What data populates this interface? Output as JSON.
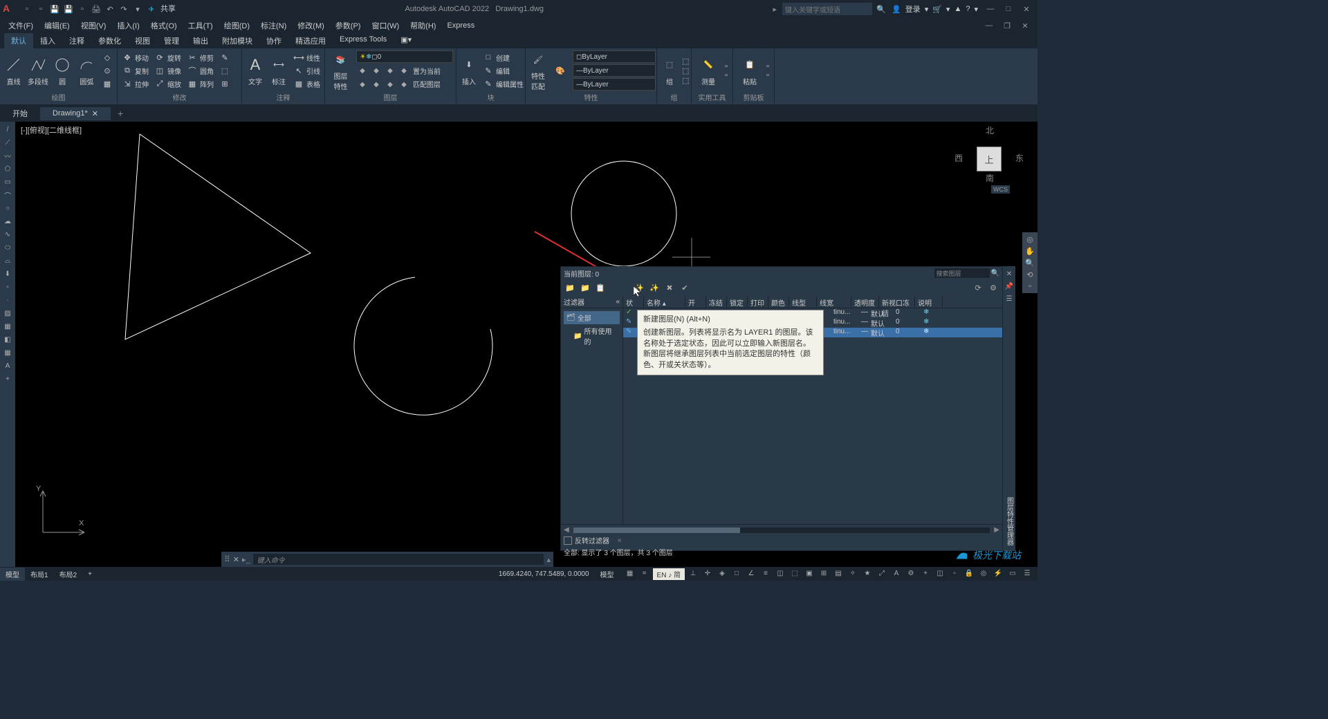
{
  "title": {
    "app": "Autodesk AutoCAD 2022",
    "file": "Drawing1.dwg"
  },
  "qat_share": "共享",
  "search_placeholder": "键入关键字或短语",
  "login_label": "登录",
  "menu": {
    "file": "文件(F)",
    "edit": "编辑(E)",
    "view": "视图(V)",
    "insert": "插入(I)",
    "format": "格式(O)",
    "tools": "工具(T)",
    "draw": "绘图(D)",
    "dimension": "标注(N)",
    "modify": "修改(M)",
    "param": "参数(P)",
    "window": "窗口(W)",
    "help": "帮助(H)",
    "express": "Express"
  },
  "ribbon_tabs": {
    "default": "默认",
    "insert": "插入",
    "annotate": "注释",
    "param": "参数化",
    "view": "视图",
    "manage": "管理",
    "output": "输出",
    "addons": "附加模块",
    "collab": "协作",
    "featured": "精选应用",
    "express": "Express Tools"
  },
  "ribbon": {
    "draw": {
      "title": "绘图",
      "line": "直线",
      "polyline": "多段线",
      "circle": "圆",
      "arc": "圆弧"
    },
    "modify": {
      "title": "修改",
      "move": "移动",
      "rotate": "旋转",
      "trim": "修剪",
      "copy": "复制",
      "mirror": "镜像",
      "fillet": "圆角",
      "stretch": "拉伸",
      "scale": "缩放",
      "array": "阵列"
    },
    "annotate": {
      "title": "注释",
      "text": "文字",
      "dim": "标注",
      "linear": "线性",
      "leader": "引线",
      "table": "表格"
    },
    "layer": {
      "title": "图层",
      "prop": "图层\n特性",
      "current": "置为当前",
      "match": "匹配图层",
      "layer0": "0"
    },
    "block": {
      "title": "块",
      "insert": "插入",
      "create": "创建",
      "edit": "编辑",
      "attr": "编辑属性"
    },
    "props": {
      "title": "特性",
      "match": "特性\n匹配",
      "bylayer": "ByLayer"
    },
    "group": {
      "title": "组",
      "group": "组"
    },
    "utils": {
      "title": "实用工具",
      "measure": "测量"
    },
    "clip": {
      "title": "剪贴板",
      "paste": "粘贴"
    }
  },
  "doc_tabs": {
    "start": "开始",
    "drawing": "Drawing1*"
  },
  "viewport": {
    "label": "[-][俯视][二维线框]"
  },
  "viewcube": {
    "north": "北",
    "south": "南",
    "east": "东",
    "west": "西",
    "top": "上",
    "wcs": "WCS"
  },
  "ucs": {
    "x": "X",
    "y": "Y"
  },
  "layer_palette": {
    "current_label": "当前图层: 0",
    "search_placeholder": "搜索图层",
    "filter_header": "过滤器",
    "filter_all": "全部",
    "filter_used": "所有使用的",
    "cols": {
      "status": "状",
      "name": "名称",
      "on": "开",
      "freeze": "冻结",
      "lock": "锁定",
      "plot": "打印",
      "color": "颜色",
      "linetype": "线型",
      "lineweight": "线宽",
      "trans": "透明度",
      "vpfreeze": "新视口冻结",
      "desc": "说明"
    },
    "rows": [
      {
        "ltype": "tinu...",
        "lw": "—",
        "lwname": "默认",
        "trans": "0"
      },
      {
        "ltype": "tinu...",
        "lw": "—",
        "lwname": "默认",
        "trans": "0"
      },
      {
        "ltype": "tinu...",
        "lw": "—",
        "lwname": "默认",
        "trans": "0"
      }
    ],
    "reverse_filter": "反转过滤器",
    "footer_status": "全部: 显示了 3 个图层，共 3 个图层",
    "side_title": "图层特性管理器"
  },
  "tooltip": {
    "title": "新建图层(N) (Alt+N)",
    "body": "创建新图层。列表将显示名为 LAYER1 的图层。该名称处于选定状态，因此可以立即输入新图层名。新图层将继承图层列表中当前选定图层的特性（颜色、开或关状态等）。"
  },
  "cmdline": {
    "placeholder": "键入命令"
  },
  "status": {
    "model": "模型",
    "layout1": "布局1",
    "layout2": "布局2",
    "coords": "1669.4240, 747.5489, 0.0000",
    "model2": "模型",
    "lang": "EN ♪ 简"
  },
  "watermark": "极光下载站"
}
